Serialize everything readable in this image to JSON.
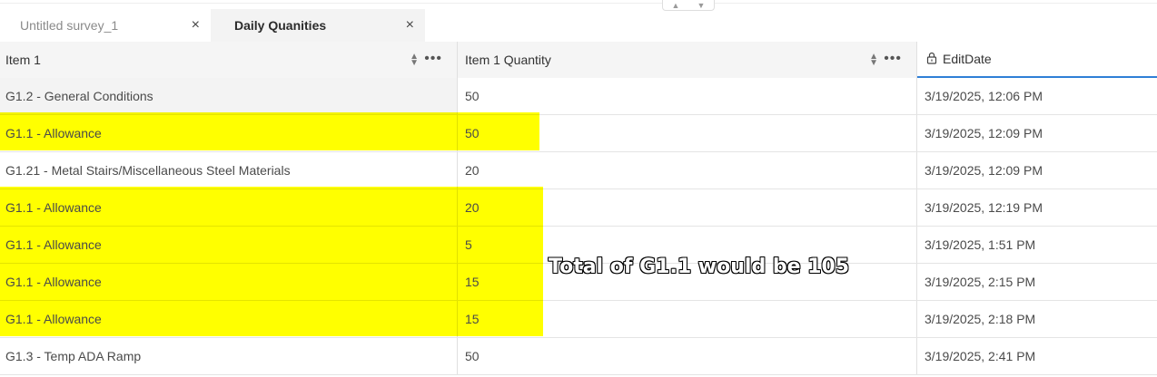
{
  "tabs": [
    {
      "label": "Untitled survey_1",
      "active": false
    },
    {
      "label": "Daily Quanities",
      "active": true
    }
  ],
  "icons": {
    "close": "×",
    "sort": "⇕",
    "more": "•••",
    "lock": "lock-icon",
    "scroll_up": "▲",
    "scroll_down": "▼"
  },
  "table": {
    "columns": [
      "Item 1",
      "Item 1 Quantity",
      "EditDate"
    ],
    "rows": [
      {
        "item": "G1.2 - General Conditions",
        "quantity": "50",
        "edit_date": "3/19/2025, 12:06 PM",
        "highlighted": false
      },
      {
        "item": "G1.1 - Allowance",
        "quantity": "50",
        "edit_date": "3/19/2025, 12:09 PM",
        "highlighted": true
      },
      {
        "item": "G1.21 - Metal Stairs/Miscellaneous Steel Materials",
        "quantity": "20",
        "edit_date": "3/19/2025, 12:09 PM",
        "highlighted": false
      },
      {
        "item": "G1.1 - Allowance",
        "quantity": "20",
        "edit_date": "3/19/2025, 12:19 PM",
        "highlighted": true
      },
      {
        "item": "G1.1 - Allowance",
        "quantity": "5",
        "edit_date": "3/19/2025, 1:51 PM",
        "highlighted": true
      },
      {
        "item": "G1.1 - Allowance",
        "quantity": "15",
        "edit_date": "3/19/2025, 2:15 PM",
        "highlighted": true
      },
      {
        "item": "G1.1 - Allowance",
        "quantity": "15",
        "edit_date": "3/19/2025, 2:18 PM",
        "highlighted": true
      },
      {
        "item": "G1.3 - Temp ADA Ramp",
        "quantity": "50",
        "edit_date": "3/19/2025, 2:41 PM",
        "highlighted": false
      }
    ]
  },
  "annotation": "Total of G1.1 would be 105",
  "colors": {
    "highlight": "#ffff00",
    "active_header_underline": "#2f7fd6"
  }
}
